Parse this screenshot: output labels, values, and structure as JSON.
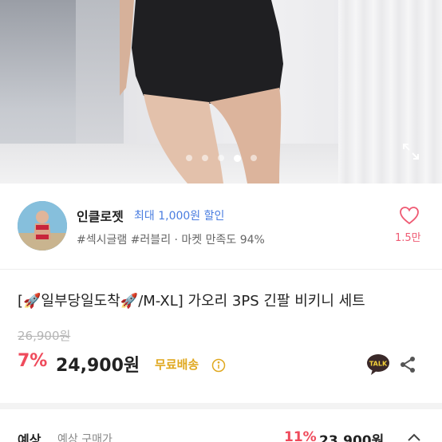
{
  "product_image": {
    "carousel_total": 5,
    "carousel_active": 4,
    "expand_icon": "expand-icon"
  },
  "seller": {
    "name": "인클로젯",
    "coupon": "최대 1,000원 할인",
    "tags": "#섹시글램 #러블리 · 마켓 만족도 94%",
    "likes": "1.5만",
    "like_icon": "heart-icon"
  },
  "product": {
    "title": "[🚀일부당일도착🚀/M-XL] 가오리 3PS 긴팔 비키니 세트",
    "original_price": "26,900원",
    "discount": "7%",
    "price": "24,900원",
    "shipping": "무료배송",
    "talk_label": "TALK"
  },
  "promo": {
    "label": "예상",
    "sub": "예상 구매가",
    "discount": "11%",
    "price": "23,900원"
  },
  "colors": {
    "discount": "#ef4b5c",
    "shipping": "#e0a81f",
    "coupon": "#4a7de0",
    "like": "#ef5a73"
  }
}
